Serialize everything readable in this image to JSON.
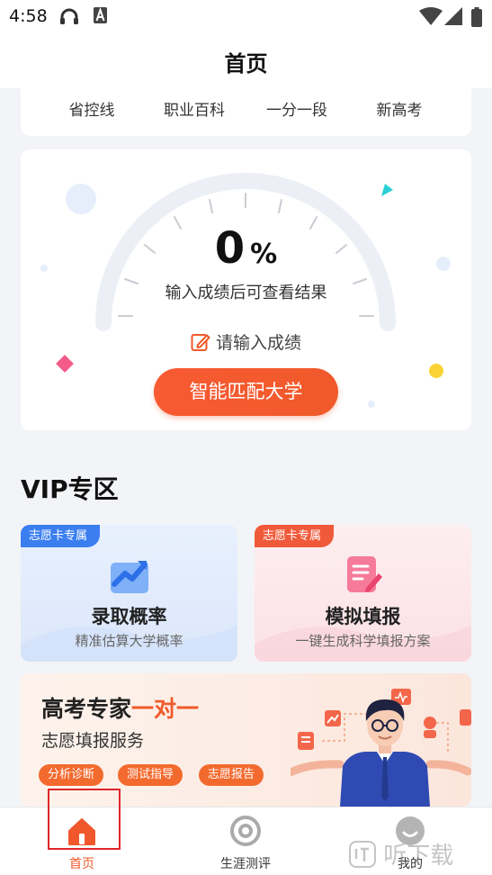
{
  "status_bar": {
    "time": "4:58"
  },
  "app_bar": {
    "title": "首页"
  },
  "quick_nav": [
    "省控线",
    "职业百科",
    "一分一段",
    "新高考"
  ],
  "score_card": {
    "score": "0",
    "unit": "%",
    "hint": "输入成绩后可查看结果",
    "enter_label": "请输入成绩",
    "match_button": "智能匹配大学"
  },
  "vip": {
    "title": "VIP专区",
    "cards": [
      {
        "tag": "志愿卡专属",
        "title": "录取概率",
        "subtitle": "精准估算大学概率",
        "icon": "trend-chart-icon"
      },
      {
        "tag": "志愿卡专属",
        "title": "模拟填报",
        "subtitle": "一键生成科学填报方案",
        "icon": "edit-doc-icon"
      }
    ]
  },
  "expert": {
    "title_plain": "高考专家",
    "title_highlight": "一对一",
    "subtitle": "志愿填报服务",
    "pills": [
      "分析诊断",
      "测试指导",
      "志愿报告"
    ]
  },
  "tab_bar": {
    "tabs": [
      {
        "label": "首页",
        "icon": "home-icon",
        "active": true
      },
      {
        "label": "生涯测评",
        "icon": "target-icon",
        "active": false
      },
      {
        "label": "我的",
        "icon": "profile-icon",
        "active": false
      }
    ]
  },
  "watermark": "听下载",
  "colors": {
    "accent": "#f05a2b",
    "blue": "#3a7ef0",
    "background": "#f3f4f7"
  }
}
